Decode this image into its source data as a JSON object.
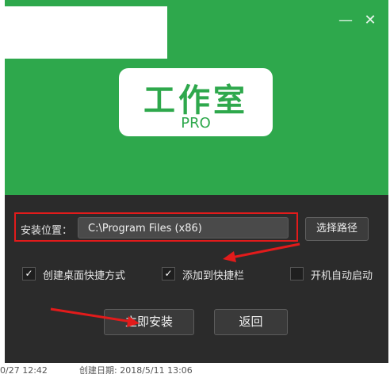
{
  "window": {
    "minimize_icon": "minimize-icon",
    "close_icon": "close-icon"
  },
  "logo": {
    "title": "工作室",
    "subtitle": "PRO"
  },
  "install_path": {
    "label": "安装位置：",
    "value": "C:\\Program Files (x86)",
    "browse_label": "选择路径"
  },
  "options": [
    {
      "label": "创建桌面快捷方式",
      "checked": true
    },
    {
      "label": "添加到快捷栏",
      "checked": true
    },
    {
      "label": "开机自动启动",
      "checked": false
    }
  ],
  "buttons": {
    "install": "立即安装",
    "back": "返回"
  },
  "footer": {
    "left": "0/27 12:42",
    "right": "创建日期: 2018/5/11 13:06"
  },
  "colors": {
    "header_green": "#2ea84c",
    "body_dark": "#2b2b2b",
    "highlight_red": "#e21b1b"
  }
}
